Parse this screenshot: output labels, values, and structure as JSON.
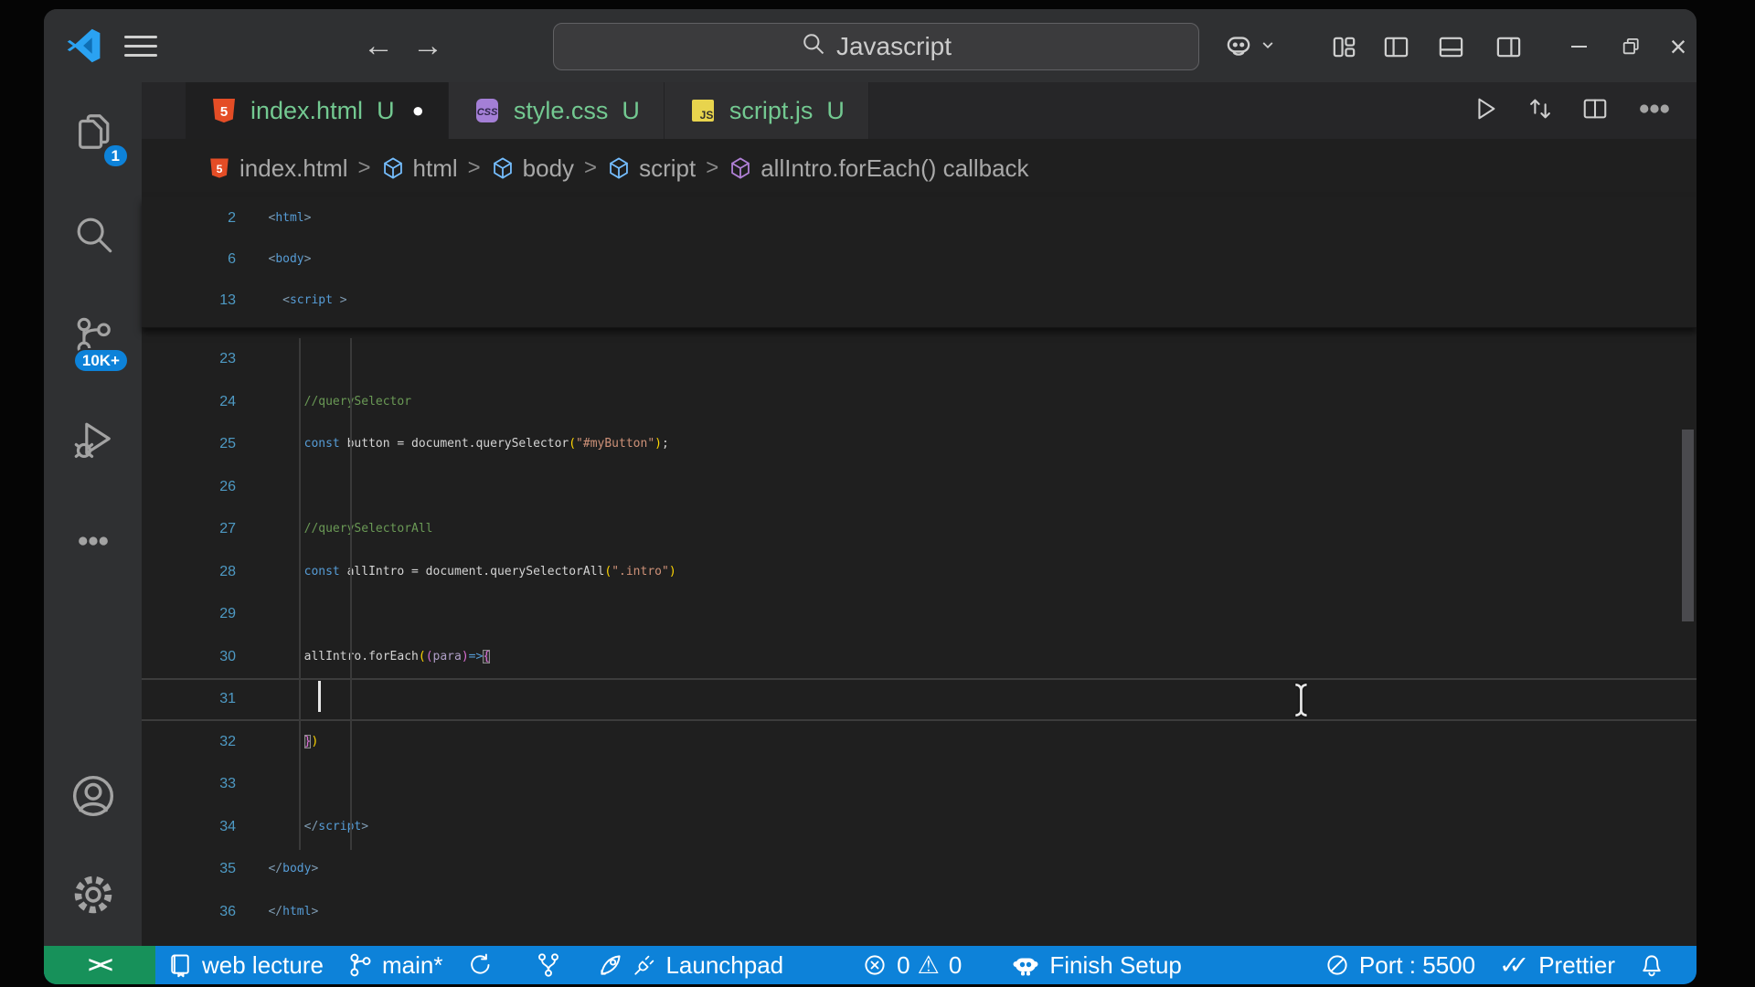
{
  "title_bar": {
    "search": {
      "value": "Javascript"
    }
  },
  "activity_bar": {
    "items": [
      {
        "name": "explorer",
        "icon": "files-icon",
        "badge": "1"
      },
      {
        "name": "search",
        "icon": "search-icon"
      },
      {
        "name": "source-control",
        "icon": "source-control-icon",
        "badge": "10K+"
      },
      {
        "name": "run-debug",
        "icon": "debug-icon"
      },
      {
        "name": "more",
        "icon": "ellipsis-icon"
      }
    ],
    "bottom": [
      {
        "name": "account",
        "icon": "account-icon"
      },
      {
        "name": "settings",
        "icon": "gear-icon"
      }
    ]
  },
  "tabs": [
    {
      "label": "index.html",
      "git": "U",
      "icon": "html",
      "active": true,
      "dirty": true
    },
    {
      "label": "style.css",
      "git": "U",
      "icon": "css",
      "active": false,
      "dirty": false
    },
    {
      "label": "script.js",
      "git": "U",
      "icon": "js",
      "active": false,
      "dirty": false
    }
  ],
  "editor_actions": [
    {
      "name": "run",
      "icon": "play-icon"
    },
    {
      "name": "compare-changes",
      "icon": "compare-icon"
    },
    {
      "name": "split-editor",
      "icon": "split-icon"
    },
    {
      "name": "more-actions",
      "icon": "ellipsis-icon"
    }
  ],
  "breadcrumb": [
    {
      "icon": "html-file-icon",
      "label": "index.html"
    },
    {
      "icon": "symbol-cube-blue-icon",
      "label": "html"
    },
    {
      "icon": "symbol-cube-blue-icon",
      "label": "body"
    },
    {
      "icon": "symbol-cube-blue-icon",
      "label": "script"
    },
    {
      "icon": "symbol-cube-purple-icon",
      "label": "allIntro.forEach() callback"
    }
  ],
  "editor": {
    "sticky": [
      {
        "n": "2",
        "indent": 3,
        "tokens": [
          [
            "<",
            "tp"
          ],
          [
            "html",
            "tag"
          ],
          [
            ">",
            "tp"
          ]
        ]
      },
      {
        "n": "6",
        "indent": 3,
        "tokens": [
          [
            "<",
            "tp"
          ],
          [
            "body",
            "tag"
          ],
          [
            ">",
            "tp"
          ]
        ]
      },
      {
        "n": "13",
        "indent": 5,
        "tokens": [
          [
            "<",
            "tp"
          ],
          [
            "script ",
            "tag"
          ],
          [
            ">",
            "tp"
          ]
        ]
      }
    ],
    "lines": [
      {
        "n": "23",
        "indent": 0,
        "tokens": []
      },
      {
        "n": "24",
        "indent": 8,
        "tokens": [
          [
            "//querySelector",
            "cm"
          ]
        ]
      },
      {
        "n": "25",
        "indent": 8,
        "tokens": [
          [
            "const",
            "kw"
          ],
          [
            " button = document.querySelector",
            "pl"
          ],
          [
            "(",
            "b1"
          ],
          [
            "\"#myButton\"",
            "st"
          ],
          [
            ")",
            "b1"
          ],
          [
            ";",
            "pl"
          ]
        ]
      },
      {
        "n": "26",
        "indent": 0,
        "tokens": []
      },
      {
        "n": "27",
        "indent": 8,
        "tokens": [
          [
            "//querySelectorAll",
            "cm"
          ]
        ]
      },
      {
        "n": "28",
        "indent": 8,
        "tokens": [
          [
            "const",
            "kw"
          ],
          [
            " allIntro = document.querySelectorAll",
            "pl"
          ],
          [
            "(",
            "b1"
          ],
          [
            "\".intro\"",
            "st"
          ],
          [
            ")",
            "b1"
          ]
        ]
      },
      {
        "n": "29",
        "indent": 0,
        "tokens": []
      },
      {
        "n": "30",
        "indent": 8,
        "tokens": [
          [
            "allIntro.forEach",
            "pl"
          ],
          [
            "(",
            "b1"
          ],
          [
            "(",
            "b2"
          ],
          [
            "para",
            "pr"
          ],
          [
            ")",
            "b2"
          ],
          [
            "=>",
            "kw"
          ],
          [
            "{",
            "b2m"
          ]
        ]
      },
      {
        "n": "31",
        "indent": 10,
        "cursor": true,
        "tokens": []
      },
      {
        "n": "32",
        "indent": 8,
        "tokens": [
          [
            "}",
            "b2m"
          ],
          [
            ")",
            "b1"
          ]
        ]
      },
      {
        "n": "33",
        "indent": 0,
        "tokens": []
      },
      {
        "n": "34",
        "indent": 8,
        "tokens": [
          [
            "</",
            "tp"
          ],
          [
            "script",
            "tag"
          ],
          [
            ">",
            "tp"
          ]
        ]
      },
      {
        "n": "35",
        "indent": 3,
        "tokens": [
          [
            "</",
            "tp"
          ],
          [
            "body",
            "tag"
          ],
          [
            ">",
            "tp"
          ]
        ]
      },
      {
        "n": "36",
        "indent": 3,
        "tokens": [
          [
            "</",
            "tp"
          ],
          [
            "html",
            "tag"
          ],
          [
            ">",
            "tp"
          ]
        ]
      }
    ]
  },
  "status_bar": {
    "left": [
      {
        "name": "remote",
        "icon": "remote-icon",
        "label": ""
      },
      {
        "name": "web-lecture",
        "icon": "book-icon",
        "label": "web lecture"
      },
      {
        "name": "git-branch",
        "icon": "git-branch-icon",
        "label": "main*"
      },
      {
        "name": "sync",
        "icon": "sync-icon",
        "label": ""
      },
      {
        "name": "fork",
        "icon": "git-fork-icon",
        "label": ""
      },
      {
        "name": "launchpad",
        "icons": [
          "rocket-icon",
          "plug-icon"
        ],
        "label": "Launchpad"
      },
      {
        "name": "errors",
        "icon": "error-icon",
        "label": "0"
      },
      {
        "name": "warnings",
        "icon": "warning-icon",
        "label": "0"
      }
    ],
    "right": [
      {
        "name": "finish-setup",
        "icon": "copilot-icon",
        "label": "Finish Setup"
      },
      {
        "name": "port",
        "icon": "circle-slash-icon",
        "label": "Port : 5500"
      },
      {
        "name": "prettier",
        "icon": "double-check-icon",
        "label": "Prettier"
      },
      {
        "name": "bell",
        "icon": "bell-icon",
        "label": ""
      }
    ]
  },
  "colors": {
    "status_bg": "#0d82d9",
    "remote_bg": "#17915a",
    "badge_bg": "#0d82d9",
    "git_untracked": "#73c991",
    "string": "#ce9178",
    "comment": "#6a9955",
    "keyword": "#569cd6"
  }
}
